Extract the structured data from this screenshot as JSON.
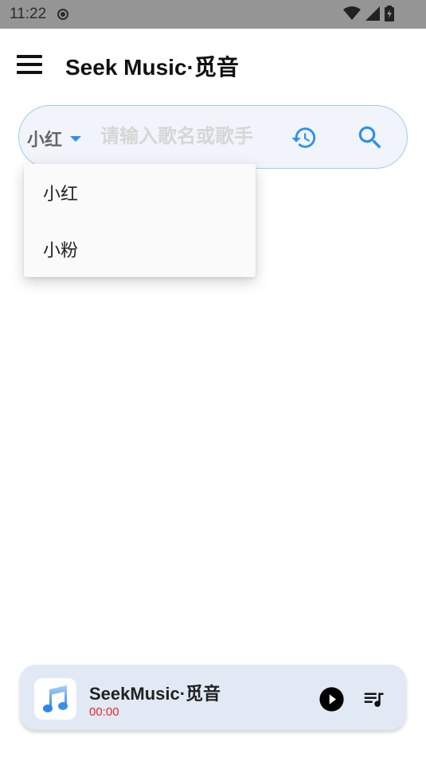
{
  "status_bar": {
    "time": "11:22",
    "icons": [
      "record-icon",
      "wifi-icon",
      "signal-icon",
      "battery-charging-icon"
    ]
  },
  "app_bar": {
    "title": "Seek Music·觅音",
    "menu_icon": "hamburger-menu-icon"
  },
  "search": {
    "source_selected": "小红",
    "placeholder": "请输入歌名或歌手",
    "value": "",
    "history_icon": "history-icon",
    "search_icon": "search-icon",
    "accent_color": "#2a8ff0"
  },
  "source_dropdown": {
    "options": [
      {
        "label": "小红"
      },
      {
        "label": "小粉"
      }
    ]
  },
  "player": {
    "title": "SeekMusic·觅音",
    "time": "00:00",
    "time_color": "#e8262a",
    "album_icon": "music-note-icon",
    "play_icon": "play-circle-icon",
    "queue_icon": "queue-music-icon"
  }
}
